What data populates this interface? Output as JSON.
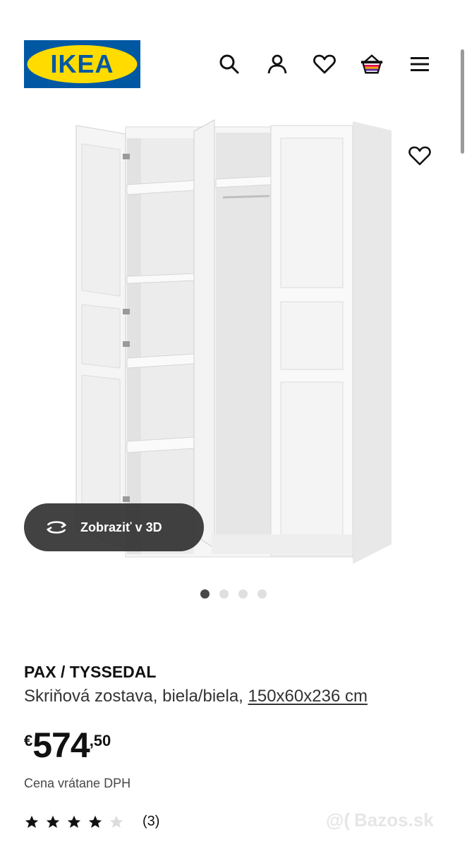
{
  "header": {
    "logo_text": "IKEA",
    "icons": [
      "search-icon",
      "user-icon",
      "heart-icon",
      "basket-icon",
      "menu-icon"
    ]
  },
  "gallery": {
    "view_3d_label": "Zobraziť v 3D",
    "dots_total": 4,
    "active_dot": 1
  },
  "product": {
    "name": "PAX / TYSSEDAL",
    "description": "Skriňová zostava, biela/biela,",
    "dimensions": "150x60x236 cm",
    "price_currency": "€",
    "price_main": "574",
    "price_cents": ",50",
    "vat_note": "Cena vrátane DPH",
    "rating_value": 4,
    "rating_max": 5,
    "rating_count": "(3)"
  },
  "watermark": {
    "text": "Bazos.sk"
  },
  "colors": {
    "ikea_blue": "#0058a3",
    "ikea_yellow": "#ffdb00",
    "pill_bg": "#333333",
    "text": "#111111"
  }
}
